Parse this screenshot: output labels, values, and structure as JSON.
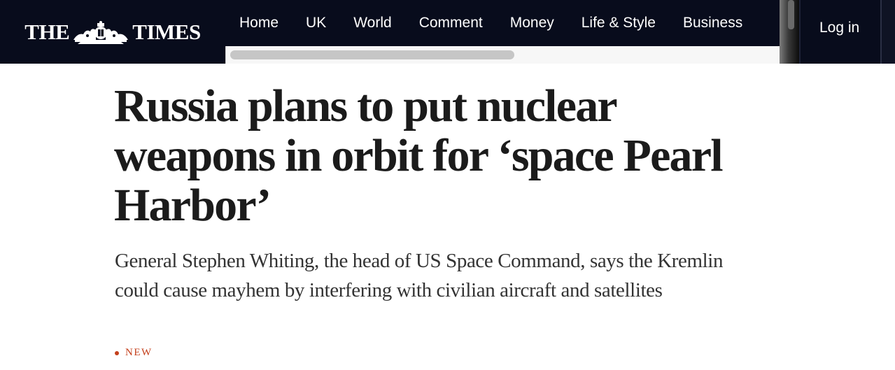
{
  "masthead": {
    "word_left": "THE",
    "word_right": "TIMES",
    "crest_icon": "royal-crest-icon"
  },
  "nav": {
    "items": [
      {
        "label": "Home"
      },
      {
        "label": "UK"
      },
      {
        "label": "World"
      },
      {
        "label": "Comment"
      },
      {
        "label": "Money"
      },
      {
        "label": "Life & Style"
      },
      {
        "label": "Business"
      }
    ],
    "login_label": "Log in"
  },
  "article": {
    "headline": "Russia plans to put nuclear weapons in orbit for ‘space Pearl Harbor’",
    "standfirst": "General Stephen Whiting, the head of US Space Command, says the Kremlin could cause mayhem by interfering with civilian aircraft and satellites",
    "tag": "NEW"
  },
  "colors": {
    "header_bg": "#080c1c",
    "accent": "#c4401c",
    "headline_text": "#1b1b1b"
  }
}
